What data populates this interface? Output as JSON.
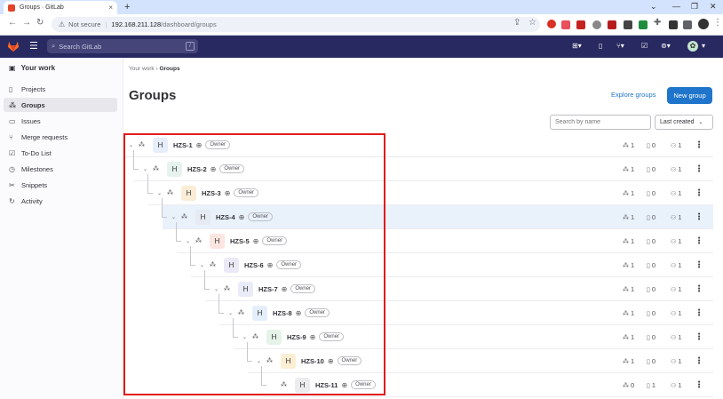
{
  "browser": {
    "tab_title": "Groups · GitLab",
    "tab_close": "×",
    "new_tab": "+",
    "security": "Not secure",
    "url_host": "192.168.211.128",
    "url_path": "/dashboard/groups",
    "window_controls": [
      "⌄",
      "—",
      "❐",
      "✕"
    ]
  },
  "gitlab_header": {
    "search_placeholder": "Search GitLab",
    "search_shortcut": "/"
  },
  "sidebar": {
    "section": "Your work",
    "items": [
      {
        "label": "Projects",
        "icon": "project-icon",
        "active": false
      },
      {
        "label": "Groups",
        "icon": "group-icon",
        "active": true
      },
      {
        "label": "Issues",
        "icon": "issues-icon",
        "active": false
      },
      {
        "label": "Merge requests",
        "icon": "merge-request-icon",
        "active": false
      },
      {
        "label": "To-Do List",
        "icon": "todo-icon",
        "active": false
      },
      {
        "label": "Milestones",
        "icon": "milestone-icon",
        "active": false
      },
      {
        "label": "Snippets",
        "icon": "snippet-icon",
        "active": false
      },
      {
        "label": "Activity",
        "icon": "activity-icon",
        "active": false
      }
    ]
  },
  "breadcrumb": {
    "root": "Your work",
    "current": "Groups"
  },
  "page": {
    "title": "Groups",
    "explore_label": "Explore groups",
    "new_group_label": "New group",
    "search_placeholder": "Search by name",
    "sort_label": "Last created"
  },
  "groups": [
    {
      "name": "HZS-1",
      "avatar": "H",
      "role": "Owner",
      "subgroups": "1",
      "projects": "0",
      "members": "1",
      "color": "#e7eefb"
    },
    {
      "name": "HZS-2",
      "avatar": "H",
      "role": "Owner",
      "subgroups": "1",
      "projects": "0",
      "members": "1",
      "color": "#e6f2ee"
    },
    {
      "name": "HZS-3",
      "avatar": "H",
      "role": "Owner",
      "subgroups": "1",
      "projects": "0",
      "members": "1",
      "color": "#fbecd6"
    },
    {
      "name": "HZS-4",
      "avatar": "H",
      "role": "Owner",
      "subgroups": "1",
      "projects": "0",
      "members": "1",
      "color": "#e6eaf3"
    },
    {
      "name": "HZS-5",
      "avatar": "H",
      "role": "Owner",
      "subgroups": "1",
      "projects": "0",
      "members": "1",
      "color": "#fbe5e1"
    },
    {
      "name": "HZS-6",
      "avatar": "H",
      "role": "Owner",
      "subgroups": "1",
      "projects": "0",
      "members": "1",
      "color": "#ebe9f6"
    },
    {
      "name": "HZS-7",
      "avatar": "H",
      "role": "Owner",
      "subgroups": "1",
      "projects": "0",
      "members": "1",
      "color": "#e9ebf8"
    },
    {
      "name": "HZS-8",
      "avatar": "H",
      "role": "Owner",
      "subgroups": "1",
      "projects": "0",
      "members": "1",
      "color": "#e4eefa"
    },
    {
      "name": "HZS-9",
      "avatar": "H",
      "role": "Owner",
      "subgroups": "1",
      "projects": "0",
      "members": "1",
      "color": "#e5f3e8"
    },
    {
      "name": "HZS-10",
      "avatar": "H",
      "role": "Owner",
      "subgroups": "1",
      "projects": "0",
      "members": "1",
      "color": "#fbeed3"
    },
    {
      "name": "HZS-11",
      "avatar": "H",
      "role": "Owner",
      "subgroups": "0",
      "projects": "1",
      "members": "1",
      "color": "#ececef"
    }
  ]
}
